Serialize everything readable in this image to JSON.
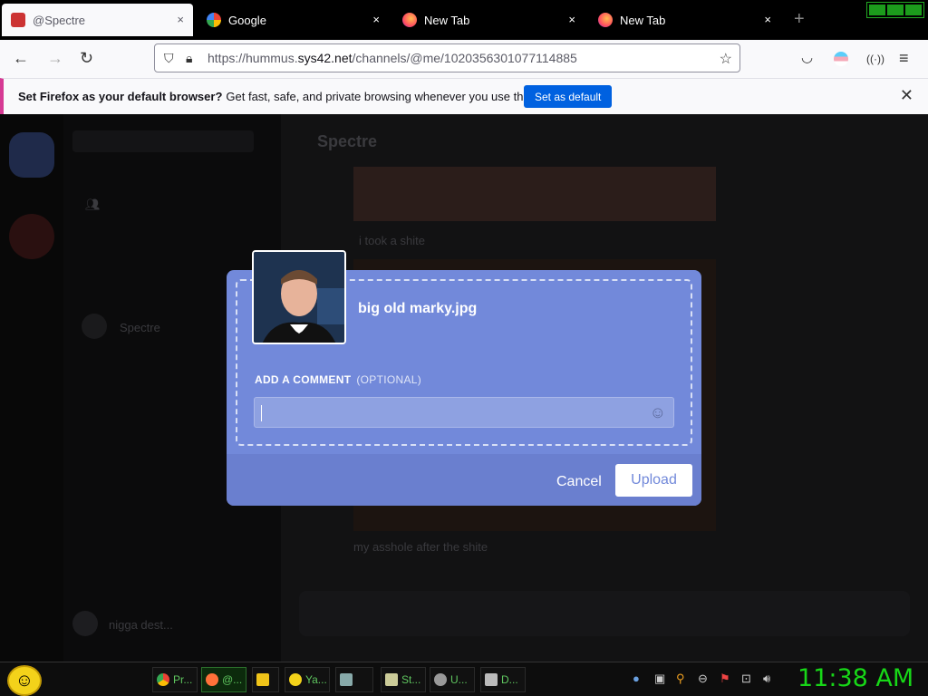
{
  "browser": {
    "tabs": [
      {
        "title": "@Spectre",
        "close": "×"
      },
      {
        "title": "Google",
        "close": "×"
      },
      {
        "title": "New Tab",
        "close": "×"
      },
      {
        "title": "New Tab",
        "close": "×"
      }
    ],
    "new_tab": "+",
    "url_prefix": "https://hummus.",
    "url_host": "sys42.net",
    "url_path": "/channels/@me/1020356301077114885"
  },
  "notification": {
    "bold": "Set Firefox as your default browser?",
    "text": "Get fast, safe, and private browsing whenever you use the web.",
    "button": "Set as default",
    "close": "✕"
  },
  "discord": {
    "channel_title": "Spectre",
    "dm_name": "Spectre",
    "msg1": "i took a shite",
    "msg2": "my asshole after the shite",
    "user": "nigga dest..."
  },
  "modal": {
    "filename": "big old marky.jpg",
    "comment_label": "Add a comment",
    "comment_optional": "(Optional)",
    "cancel": "Cancel",
    "upload": "Upload"
  },
  "taskbar": {
    "items": [
      "Pr...",
      "@...",
      "",
      "Ya...",
      "",
      "St...",
      "U...",
      "D..."
    ],
    "clock": "11:38 AM"
  }
}
